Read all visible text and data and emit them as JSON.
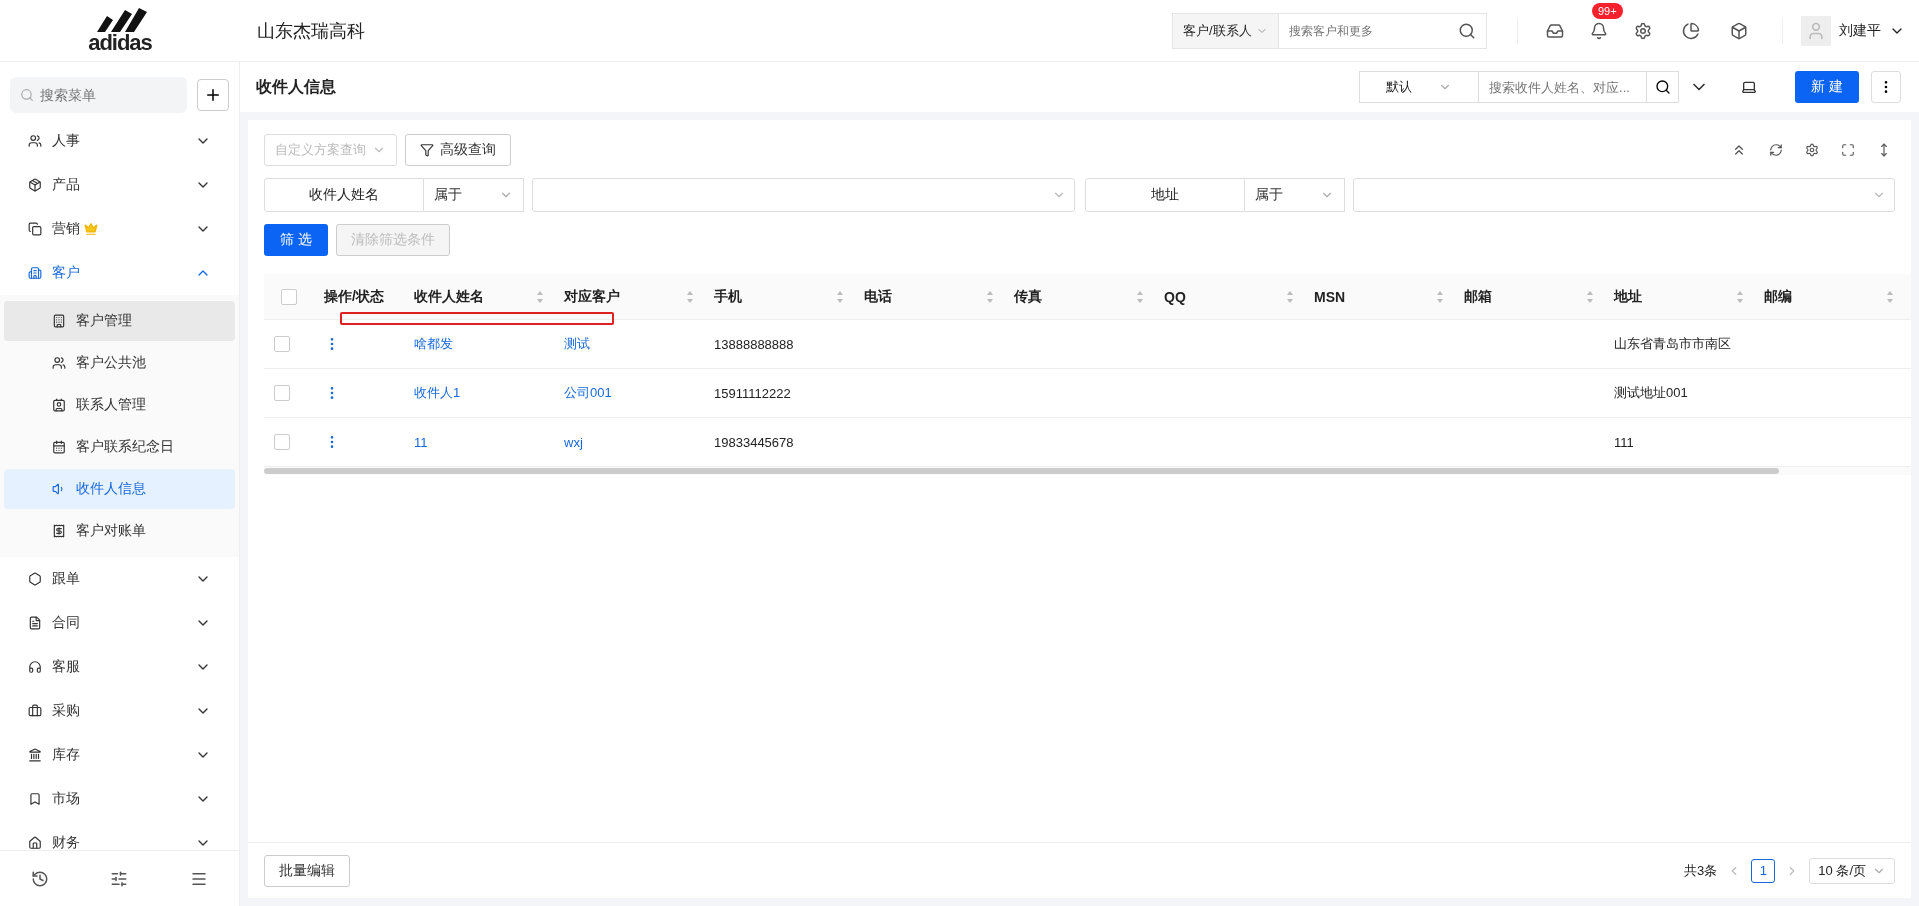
{
  "brand": {
    "logo": "adidas",
    "company": "山东杰瑞高科"
  },
  "global_search": {
    "scope": "客户/联系人",
    "placeholder": "搜索客户和更多"
  },
  "notifications": {
    "badge": "99+"
  },
  "user": {
    "name": "刘建平"
  },
  "sidebar": {
    "search_placeholder": "搜索菜单",
    "items": [
      {
        "label": "人事",
        "expanded": false,
        "selected": false,
        "premium": false
      },
      {
        "label": "产品",
        "expanded": false,
        "selected": false,
        "premium": false
      },
      {
        "label": "营销",
        "expanded": false,
        "selected": false,
        "premium": true
      },
      {
        "label": "客户",
        "expanded": true,
        "selected": true,
        "premium": false,
        "children": [
          {
            "label": "客户管理",
            "selected": false,
            "hovered": true
          },
          {
            "label": "客户公共池",
            "selected": false,
            "hovered": false
          },
          {
            "label": "联系人管理",
            "selected": false,
            "hovered": false
          },
          {
            "label": "客户联系纪念日",
            "selected": false,
            "hovered": false
          },
          {
            "label": "收件人信息",
            "selected": true,
            "hovered": false
          },
          {
            "label": "客户对账单",
            "selected": false,
            "hovered": false
          }
        ]
      },
      {
        "label": "跟单",
        "expanded": false,
        "selected": false,
        "premium": false
      },
      {
        "label": "合同",
        "expanded": false,
        "selected": false,
        "premium": false
      },
      {
        "label": "客服",
        "expanded": false,
        "selected": false,
        "premium": false
      },
      {
        "label": "采购",
        "expanded": false,
        "selected": false,
        "premium": false
      },
      {
        "label": "库存",
        "expanded": false,
        "selected": false,
        "premium": false
      },
      {
        "label": "市场",
        "expanded": false,
        "selected": false,
        "premium": false
      },
      {
        "label": "财务",
        "expanded": false,
        "selected": false,
        "premium": false
      }
    ]
  },
  "page_header": {
    "title": "收件人信息",
    "view": "默认",
    "search_placeholder": "搜索收件人姓名、对应...",
    "new_button": "新 建"
  },
  "toolbar": {
    "scheme_placeholder": "自定义方案查询",
    "advanced": "高级查询"
  },
  "filters": [
    {
      "field": "收件人姓名",
      "operator": "属于"
    },
    {
      "field": "地址",
      "operator": "属于"
    }
  ],
  "filter_buttons": [
    {
      "label": "筛 选",
      "disabled": false
    },
    {
      "label": "清除筛选条件",
      "disabled": true
    }
  ],
  "table": {
    "all_checked": false,
    "columns": [
      {
        "label": "操作/状态",
        "kind": "actions",
        "sortable": false
      },
      {
        "label": "收件人姓名",
        "kind": "link",
        "sortable": true
      },
      {
        "label": "对应客户",
        "kind": "link",
        "sortable": true
      },
      {
        "label": "手机",
        "kind": "text",
        "sortable": true
      },
      {
        "label": "电话",
        "kind": "text",
        "sortable": true
      },
      {
        "label": "传真",
        "kind": "text",
        "sortable": true
      },
      {
        "label": "QQ",
        "kind": "text",
        "sortable": true
      },
      {
        "label": "MSN",
        "kind": "text",
        "sortable": true
      },
      {
        "label": "邮箱",
        "kind": "text",
        "sortable": true
      },
      {
        "label": "地址",
        "kind": "text",
        "sortable": true
      },
      {
        "label": "邮编",
        "kind": "text",
        "sortable": true
      }
    ],
    "rows": [
      {
        "checked": false,
        "name": "啥都发",
        "customer": "测试",
        "mobile": "13888888888",
        "address": "山东省青岛市市南区"
      },
      {
        "checked": false,
        "name": "收件人1",
        "customer": "公司001",
        "mobile": "15911112222",
        "address": "测试地址001"
      },
      {
        "checked": false,
        "name": "11",
        "customer": "wxj",
        "mobile": "19833445678",
        "address": "111"
      }
    ]
  },
  "footer": {
    "batch_edit": "批量编辑",
    "total": "共3条",
    "pages": [
      {
        "label": "1",
        "selected": true
      }
    ],
    "page_size": "10 条/页"
  }
}
